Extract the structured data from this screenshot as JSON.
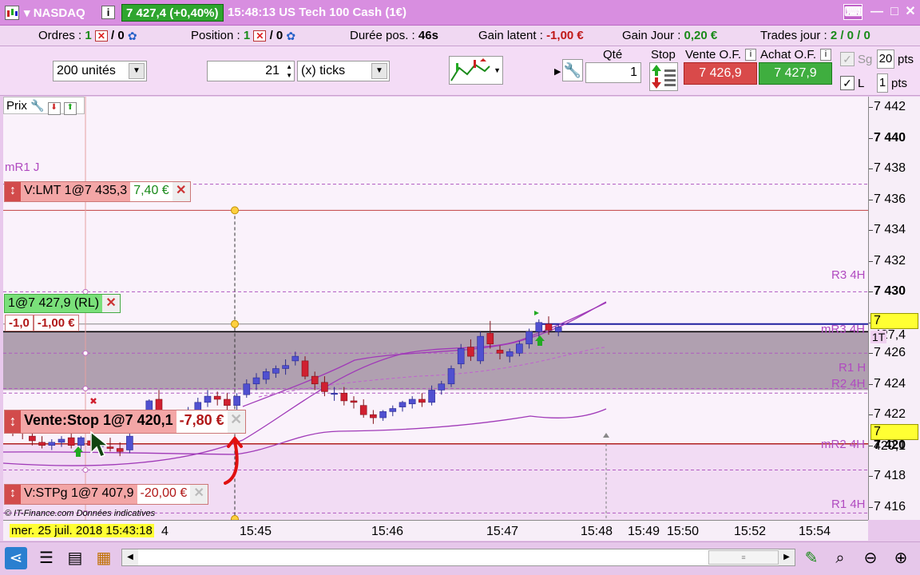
{
  "window": {
    "symbol": "NASDAQ",
    "price_change": "7 427,4 (+0,40%)",
    "time_instrument": "15:48:13 US Tech 100 Cash (1€)"
  },
  "infobar": {
    "orders_label": "Ordres :",
    "orders_value1": "1",
    "orders_value2": "/ 0",
    "position_label": "Position :",
    "position_value1": "1",
    "position_value2": "/ 0",
    "duration_label": "Durée pos. :",
    "duration_value": "46s",
    "latent_label": "Gain latent :",
    "latent_value": "-1,00 €",
    "daygain_label": "Gain Jour :",
    "daygain_value": "0,20 €",
    "trades_label": "Trades jour :",
    "trades_value": "2 / 0 / 0"
  },
  "toolbar": {
    "units": "200 unités",
    "ticks_value": "21",
    "ticks_unit": "(x) ticks",
    "qty_label": "Qté",
    "qty_value": "1",
    "stop_label": "Stop",
    "sell_label": "Vente O.F.",
    "sell_price": "7 426,9",
    "buy_label": "Achat O.F.",
    "buy_price": "7 427,9",
    "sg_label": "Sg",
    "sg_value": "20",
    "pts_label": "pts",
    "l_label": "L",
    "l_value": "1",
    "pts2_label": "pts"
  },
  "chart": {
    "prix_label": "Prix",
    "copyright": "© IT-Finance.com  Données indicatives",
    "levels": {
      "mr1j": "mR1 J",
      "r3_4h": "R3 4H",
      "mr3_4h": "mR3 4H",
      "r1h": "R1 H",
      "r2_4h": "R2 4H",
      "mr2_4h": "mR2 4H",
      "r1_4h": "R1 4H"
    },
    "orders": {
      "lmt_label": "V:LMT 1@7 435,3",
      "lmt_pnl": "7,40 €",
      "pos_label": "1@7 427,9 (RL)",
      "pos_pts": "-1,0",
      "pos_eur": "-1,00 €",
      "stop_label": "Vente:Stop 1@7 420,1",
      "stop_pnl": "-7,80 €",
      "stpg_label": "V:STPg 1@7 407,9",
      "stpg_pnl": "-20,00 €"
    },
    "price_tags": {
      "last": "7 427,4",
      "stop": "7 420,1",
      "small": "1T"
    },
    "date_label": "mer. 25 juil. 2018 15:43:18"
  },
  "chart_data": {
    "type": "candlestick",
    "y_ticks": [
      "7 442",
      "7 440",
      "7 438",
      "7 436",
      "7 434",
      "7 432",
      "7 430",
      "7 428",
      "7 426",
      "7 424",
      "7 422",
      "7 420",
      "7 418",
      "7 416"
    ],
    "bold_y_ticks": [
      "7 440",
      "7 430",
      "7 420"
    ],
    "x_ticks": [
      "4",
      "15:45",
      "15:46",
      "15:47",
      "15:48",
      "15:49",
      "15:50",
      "15:52",
      "15:54"
    ],
    "ylim": [
      7415,
      7443
    ],
    "candles": [
      [
        7421.2,
        7421.6,
        7420.6,
        7421.0
      ],
      [
        7421.0,
        7421.3,
        7420.4,
        7420.8
      ],
      [
        7420.6,
        7420.9,
        7420.0,
        7420.3
      ],
      [
        7420.2,
        7420.6,
        7419.8,
        7420.0
      ],
      [
        7420.0,
        7420.4,
        7419.7,
        7420.2
      ],
      [
        7420.2,
        7420.6,
        7419.9,
        7420.4
      ],
      [
        7420.5,
        7420.9,
        7419.8,
        7420.0
      ],
      [
        7420.0,
        7420.6,
        7419.6,
        7420.5
      ],
      [
        7420.3,
        7420.7,
        7419.6,
        7420.0
      ],
      [
        7420.0,
        7420.4,
        7419.4,
        7420.0
      ],
      [
        7419.9,
        7420.5,
        7419.6,
        7419.8
      ],
      [
        7419.8,
        7420.2,
        7419.3,
        7419.6
      ],
      [
        7419.7,
        7420.8,
        7419.5,
        7420.6
      ],
      [
        7421.0,
        7421.6,
        7420.8,
        7421.3
      ],
      [
        7421.4,
        7423.0,
        7421.2,
        7422.9
      ],
      [
        7423.0,
        7423.6,
        7421.7,
        7422.0
      ],
      [
        7421.7,
        7422.2,
        7421.2,
        7421.5
      ],
      [
        7421.5,
        7422.2,
        7421.0,
        7421.9
      ],
      [
        7421.9,
        7422.5,
        7421.6,
        7422.2
      ],
      [
        7422.2,
        7423.1,
        7421.8,
        7422.8
      ],
      [
        7422.8,
        7423.6,
        7422.5,
        7423.2
      ],
      [
        7423.2,
        7423.5,
        7422.6,
        7423.0
      ],
      [
        7423.0,
        7423.4,
        7422.2,
        7422.6
      ],
      [
        7422.6,
        7423.4,
        7422.3,
        7423.2
      ],
      [
        7423.3,
        7424.3,
        7423.1,
        7424.0
      ],
      [
        7424.0,
        7424.7,
        7423.6,
        7424.4
      ],
      [
        7424.3,
        7425.0,
        7424.0,
        7424.8
      ],
      [
        7424.7,
        7425.2,
        7424.4,
        7425.0
      ],
      [
        7425.0,
        7425.6,
        7424.6,
        7425.2
      ],
      [
        7425.5,
        7426.1,
        7425.2,
        7425.8
      ],
      [
        7425.5,
        7425.8,
        7424.3,
        7424.5
      ],
      [
        7424.5,
        7424.8,
        7423.6,
        7424.0
      ],
      [
        7424.1,
        7424.5,
        7423.2,
        7423.5
      ],
      [
        7423.4,
        7423.8,
        7422.9,
        7423.4
      ],
      [
        7423.4,
        7423.8,
        7422.6,
        7422.9
      ],
      [
        7422.9,
        7423.2,
        7422.4,
        7422.8
      ],
      [
        7422.6,
        7423.0,
        7421.8,
        7422.0
      ],
      [
        7422.0,
        7422.3,
        7421.4,
        7421.8
      ],
      [
        7421.8,
        7422.3,
        7421.6,
        7422.2
      ],
      [
        7422.2,
        7422.6,
        7421.9,
        7422.4
      ],
      [
        7422.5,
        7422.9,
        7422.2,
        7422.8
      ],
      [
        7422.7,
        7423.2,
        7422.4,
        7423.0
      ],
      [
        7423.0,
        7423.4,
        7422.5,
        7422.8
      ],
      [
        7422.8,
        7423.9,
        7422.6,
        7423.6
      ],
      [
        7423.6,
        7424.2,
        7423.3,
        7424.0
      ],
      [
        7424.0,
        7425.2,
        7423.8,
        7425.0
      ],
      [
        7425.3,
        7426.6,
        7425.0,
        7426.3
      ],
      [
        7426.4,
        7426.9,
        7425.5,
        7425.8
      ],
      [
        7425.5,
        7427.4,
        7425.3,
        7427.1
      ],
      [
        7427.3,
        7428.1,
        7426.3,
        7426.6
      ],
      [
        7426.2,
        7426.5,
        7425.6,
        7426.0
      ],
      [
        7425.8,
        7426.3,
        7425.4,
        7426.1
      ],
      [
        7426.0,
        7426.8,
        7425.8,
        7426.6
      ],
      [
        7426.6,
        7427.6,
        7426.3,
        7427.4
      ],
      [
        7427.4,
        7428.2,
        7427.0,
        7428.0
      ],
      [
        7427.9,
        7428.4,
        7427.2,
        7427.5
      ],
      [
        7427.4,
        7427.9,
        7427.1,
        7427.7
      ]
    ],
    "series": [
      {
        "name": "",
        "color": "#a03ab8",
        "style": "solid"
      },
      {
        "name": "",
        "color": "#c060d0",
        "style": "dashed"
      }
    ]
  },
  "bottombar": {
    "icons": [
      "share-icon",
      "list-icon",
      "chart-list-icon",
      "spreadsheet-icon",
      "draw-icon",
      "zoom-fit-icon",
      "zoom-out-icon",
      "zoom-in-icon"
    ]
  }
}
